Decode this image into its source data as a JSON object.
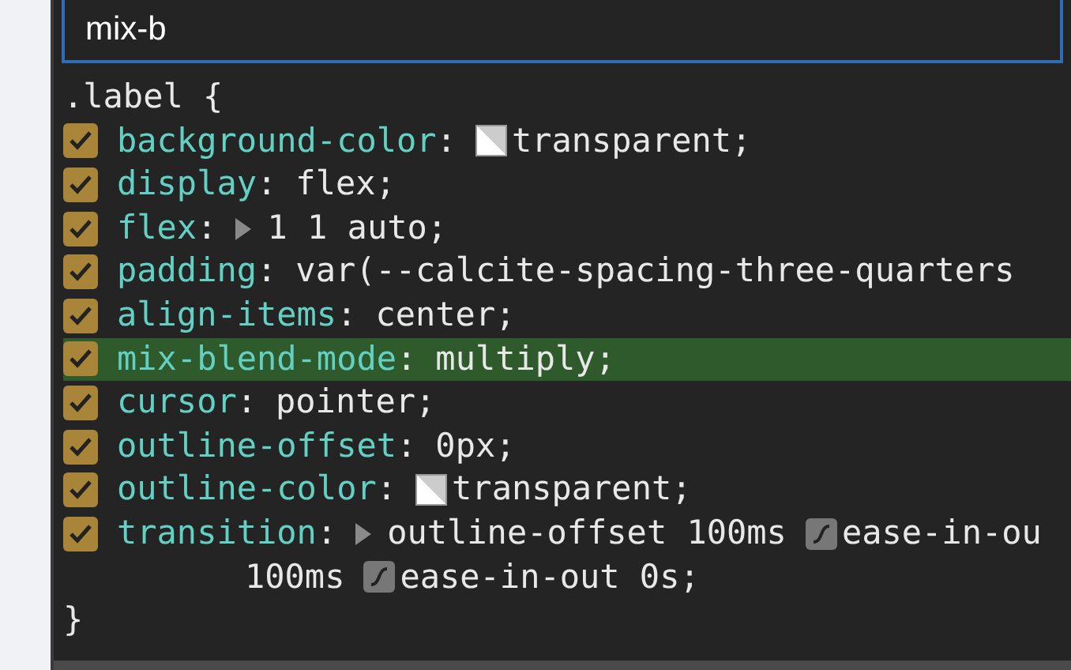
{
  "search": {
    "value": "mix-b"
  },
  "rule": {
    "selector": ".label {",
    "close": "}",
    "colon": ":",
    "declarations": [
      {
        "property": "background-color",
        "checked": true,
        "highlighted": false,
        "value": [
          {
            "kind": "swatch"
          },
          {
            "kind": "text",
            "text": "transparent;"
          }
        ]
      },
      {
        "property": "display",
        "checked": true,
        "highlighted": false,
        "value": [
          {
            "kind": "text",
            "text": "flex;"
          }
        ]
      },
      {
        "property": "flex",
        "checked": true,
        "highlighted": false,
        "value": [
          {
            "kind": "expander"
          },
          {
            "kind": "text",
            "text": "1 1 auto;"
          }
        ]
      },
      {
        "property": "padding",
        "checked": true,
        "highlighted": false,
        "value": [
          {
            "kind": "text",
            "text": "var(--calcite-spacing-three-quarters"
          }
        ]
      },
      {
        "property": "align-items",
        "checked": true,
        "highlighted": false,
        "value": [
          {
            "kind": "text",
            "text": "center;"
          }
        ]
      },
      {
        "property": "mix-blend-mode",
        "checked": true,
        "highlighted": true,
        "value": [
          {
            "kind": "text",
            "text": "multiply;"
          }
        ]
      },
      {
        "property": "cursor",
        "checked": true,
        "highlighted": false,
        "value": [
          {
            "kind": "text",
            "text": "pointer;"
          }
        ]
      },
      {
        "property": "outline-offset",
        "checked": true,
        "highlighted": false,
        "value": [
          {
            "kind": "text",
            "text": "0px;"
          }
        ]
      },
      {
        "property": "outline-color",
        "checked": true,
        "highlighted": false,
        "value": [
          {
            "kind": "swatch"
          },
          {
            "kind": "text",
            "text": "transparent;"
          }
        ]
      },
      {
        "property": "transition",
        "checked": true,
        "highlighted": false,
        "value": [
          {
            "kind": "expander"
          },
          {
            "kind": "text",
            "text": "outline-offset 100ms"
          },
          {
            "kind": "easing"
          },
          {
            "kind": "text",
            "text": "ease-in-ou"
          }
        ],
        "continuation": [
          {
            "kind": "text",
            "text": "100ms"
          },
          {
            "kind": "easing"
          },
          {
            "kind": "text",
            "text": "ease-in-out 0s;"
          }
        ]
      }
    ]
  }
}
